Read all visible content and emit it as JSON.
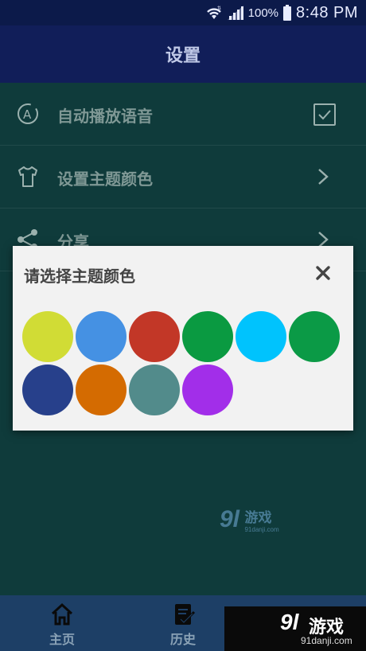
{
  "status_bar": {
    "battery": "100%",
    "time": "8:48 PM"
  },
  "app_bar": {
    "title": "设置"
  },
  "settings": [
    {
      "label": "自动播放语音",
      "icon": "auto-play-icon",
      "control": "checkbox"
    },
    {
      "label": "设置主题颜色",
      "icon": "tshirt-icon",
      "control": "chevron"
    },
    {
      "label": "分享",
      "icon": "share-icon",
      "control": "chevron"
    }
  ],
  "dialog": {
    "title": "请选择主题颜色",
    "colors": [
      "#d1dc35",
      "#4591e3",
      "#c23727",
      "#0a9a41",
      "#00c3fd",
      "#0b9a46",
      "#27408b",
      "#d46b01",
      "#528b8b",
      "#a22ee9"
    ]
  },
  "bottom_nav": [
    {
      "label": "主页",
      "icon": "home-icon"
    },
    {
      "label": "历史",
      "icon": "history-icon"
    }
  ],
  "watermark": {
    "logo": "9l",
    "name": "游戏",
    "site": "91danji.com"
  }
}
